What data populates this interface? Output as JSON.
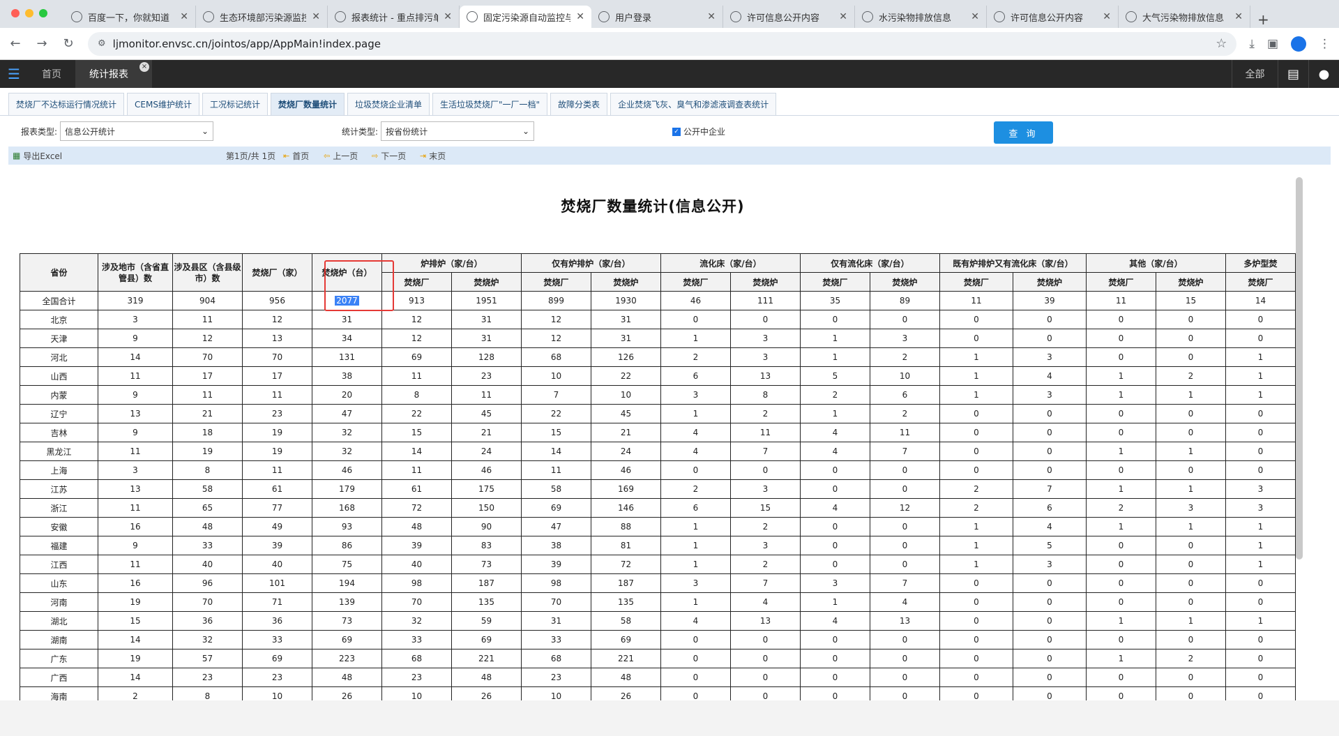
{
  "browser": {
    "tabs": [
      {
        "title": "百度一下，你就知道"
      },
      {
        "title": "生态环境部污染源监控"
      },
      {
        "title": "报表统计 - 重点排污单"
      },
      {
        "title": "固定污染源自动监控与"
      },
      {
        "title": "用户登录"
      },
      {
        "title": "许可信息公开内容"
      },
      {
        "title": "水污染物排放信息"
      },
      {
        "title": "许可信息公开内容"
      },
      {
        "title": "大气污染物排放信息"
      }
    ],
    "url": "ljmonitor.envsc.cn/jointos/app/AppMain!index.page"
  },
  "app": {
    "home_label": "首页",
    "active_tab": "统计报表",
    "all_label": "全部"
  },
  "subtabs": [
    "焚烧厂不达标运行情况统计",
    "CEMS维护统计",
    "工况标记统计",
    "焚烧厂数量统计",
    "垃圾焚烧企业清单",
    "生活垃圾焚烧厂\"一厂一档\"",
    "故障分类表",
    "企业焚烧飞灰、臭气和渗滤液调查表统计"
  ],
  "filter": {
    "report_type_label": "报表类型:",
    "report_type_value": "信息公开统计",
    "stat_type_label": "统计类型:",
    "stat_type_value": "按省份统计",
    "checkbox_label": "公开中企业",
    "query_label": "查 询"
  },
  "toolbar": {
    "export": "导出Excel",
    "page_info": "第1页/共 1页",
    "first": "首页",
    "prev": "上一页",
    "next": "下一页",
    "last": "末页"
  },
  "report": {
    "title": "焚烧厂数量统计(信息公开)",
    "head1": [
      "省份",
      "涉及地市（含省直管县）数",
      "涉及县区（含县级市）数",
      "焚烧厂（家）",
      "焚烧炉（台）"
    ],
    "group_heads": [
      "炉排炉（家/台）",
      "仅有炉排炉（家/台）",
      "流化床（家/台）",
      "仅有流化床（家/台）",
      "既有炉排炉又有流化床（家/台）",
      "其他（家/台）",
      "多炉型焚"
    ],
    "sub_heads": [
      "焚烧厂",
      "焚烧炉",
      "焚烧厂",
      "焚烧炉",
      "焚烧厂",
      "焚烧炉",
      "焚烧厂",
      "焚烧炉",
      "焚烧厂",
      "焚烧炉",
      "焚烧厂",
      "焚烧炉",
      "焚烧厂"
    ],
    "rows": [
      [
        "全国合计",
        "319",
        "904",
        "956",
        "2077",
        "913",
        "1951",
        "899",
        "1930",
        "46",
        "111",
        "35",
        "89",
        "11",
        "39",
        "11",
        "15",
        "14"
      ],
      [
        "北京",
        "3",
        "11",
        "12",
        "31",
        "12",
        "31",
        "12",
        "31",
        "0",
        "0",
        "0",
        "0",
        "0",
        "0",
        "0",
        "0",
        "0"
      ],
      [
        "天津",
        "9",
        "12",
        "13",
        "34",
        "12",
        "31",
        "12",
        "31",
        "1",
        "3",
        "1",
        "3",
        "0",
        "0",
        "0",
        "0",
        "0"
      ],
      [
        "河北",
        "14",
        "70",
        "70",
        "131",
        "69",
        "128",
        "68",
        "126",
        "2",
        "3",
        "1",
        "2",
        "1",
        "3",
        "0",
        "0",
        "1"
      ],
      [
        "山西",
        "11",
        "17",
        "17",
        "38",
        "11",
        "23",
        "10",
        "22",
        "6",
        "13",
        "5",
        "10",
        "1",
        "4",
        "1",
        "2",
        "1"
      ],
      [
        "内蒙",
        "9",
        "11",
        "11",
        "20",
        "8",
        "11",
        "7",
        "10",
        "3",
        "8",
        "2",
        "6",
        "1",
        "3",
        "1",
        "1",
        "1"
      ],
      [
        "辽宁",
        "13",
        "21",
        "23",
        "47",
        "22",
        "45",
        "22",
        "45",
        "1",
        "2",
        "1",
        "2",
        "0",
        "0",
        "0",
        "0",
        "0"
      ],
      [
        "吉林",
        "9",
        "18",
        "19",
        "32",
        "15",
        "21",
        "15",
        "21",
        "4",
        "11",
        "4",
        "11",
        "0",
        "0",
        "0",
        "0",
        "0"
      ],
      [
        "黑龙江",
        "11",
        "19",
        "19",
        "32",
        "14",
        "24",
        "14",
        "24",
        "4",
        "7",
        "4",
        "7",
        "0",
        "0",
        "1",
        "1",
        "0"
      ],
      [
        "上海",
        "3",
        "8",
        "11",
        "46",
        "11",
        "46",
        "11",
        "46",
        "0",
        "0",
        "0",
        "0",
        "0",
        "0",
        "0",
        "0",
        "0"
      ],
      [
        "江苏",
        "13",
        "58",
        "61",
        "179",
        "61",
        "175",
        "58",
        "169",
        "2",
        "3",
        "0",
        "0",
        "2",
        "7",
        "1",
        "1",
        "3"
      ],
      [
        "浙江",
        "11",
        "65",
        "77",
        "168",
        "72",
        "150",
        "69",
        "146",
        "6",
        "15",
        "4",
        "12",
        "2",
        "6",
        "2",
        "3",
        "3"
      ],
      [
        "安徽",
        "16",
        "48",
        "49",
        "93",
        "48",
        "90",
        "47",
        "88",
        "1",
        "2",
        "0",
        "0",
        "1",
        "4",
        "1",
        "1",
        "1"
      ],
      [
        "福建",
        "9",
        "33",
        "39",
        "86",
        "39",
        "83",
        "38",
        "81",
        "1",
        "3",
        "0",
        "0",
        "1",
        "5",
        "0",
        "0",
        "1"
      ],
      [
        "江西",
        "11",
        "40",
        "40",
        "75",
        "40",
        "73",
        "39",
        "72",
        "1",
        "2",
        "0",
        "0",
        "1",
        "3",
        "0",
        "0",
        "1"
      ],
      [
        "山东",
        "16",
        "96",
        "101",
        "194",
        "98",
        "187",
        "98",
        "187",
        "3",
        "7",
        "3",
        "7",
        "0",
        "0",
        "0",
        "0",
        "0"
      ],
      [
        "河南",
        "19",
        "70",
        "71",
        "139",
        "70",
        "135",
        "70",
        "135",
        "1",
        "4",
        "1",
        "4",
        "0",
        "0",
        "0",
        "0",
        "0"
      ],
      [
        "湖北",
        "15",
        "36",
        "36",
        "73",
        "32",
        "59",
        "31",
        "58",
        "4",
        "13",
        "4",
        "13",
        "0",
        "0",
        "1",
        "1",
        "1"
      ],
      [
        "湖南",
        "14",
        "32",
        "33",
        "69",
        "33",
        "69",
        "33",
        "69",
        "0",
        "0",
        "0",
        "0",
        "0",
        "0",
        "0",
        "0",
        "0"
      ],
      [
        "广东",
        "19",
        "57",
        "69",
        "223",
        "68",
        "221",
        "68",
        "221",
        "0",
        "0",
        "0",
        "0",
        "0",
        "0",
        "1",
        "2",
        "0"
      ],
      [
        "广西",
        "14",
        "23",
        "23",
        "48",
        "23",
        "48",
        "23",
        "48",
        "0",
        "0",
        "0",
        "0",
        "0",
        "0",
        "0",
        "0",
        "0"
      ],
      [
        "海南",
        "2",
        "8",
        "10",
        "26",
        "10",
        "26",
        "10",
        "26",
        "0",
        "0",
        "0",
        "0",
        "0",
        "0",
        "0",
        "0",
        "0"
      ]
    ]
  },
  "colors": {
    "highlight_border": "#e53935",
    "accent": "#1d8fe1"
  }
}
